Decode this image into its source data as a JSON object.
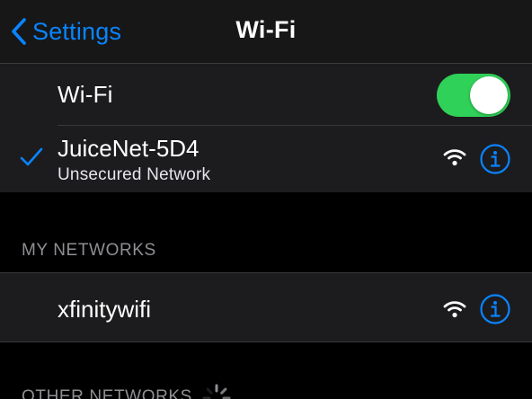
{
  "colors": {
    "accent": "#0a84ff",
    "toggle_on": "#30d158",
    "background": "#000000",
    "cell_background": "#1c1c1e",
    "section_header": "#8e8e93"
  },
  "navbar": {
    "back_label": "Settings",
    "back_icon": "chevron-left-icon",
    "title": "Wi-Fi"
  },
  "wifi_toggle": {
    "label": "Wi-Fi",
    "on": true
  },
  "connected_network": {
    "name": "JuiceNet-5D4",
    "subtitle": "Unsecured Network",
    "selected": true,
    "icons": [
      "checkmark-icon",
      "wifi-signal-icon",
      "info-icon"
    ]
  },
  "my_networks": {
    "header": "MY NETWORKS",
    "items": [
      {
        "name": "xfinitywifi",
        "icons": [
          "wifi-signal-icon",
          "info-icon"
        ]
      }
    ]
  },
  "other_networks": {
    "header": "OTHER NETWORKS",
    "loading": true
  }
}
